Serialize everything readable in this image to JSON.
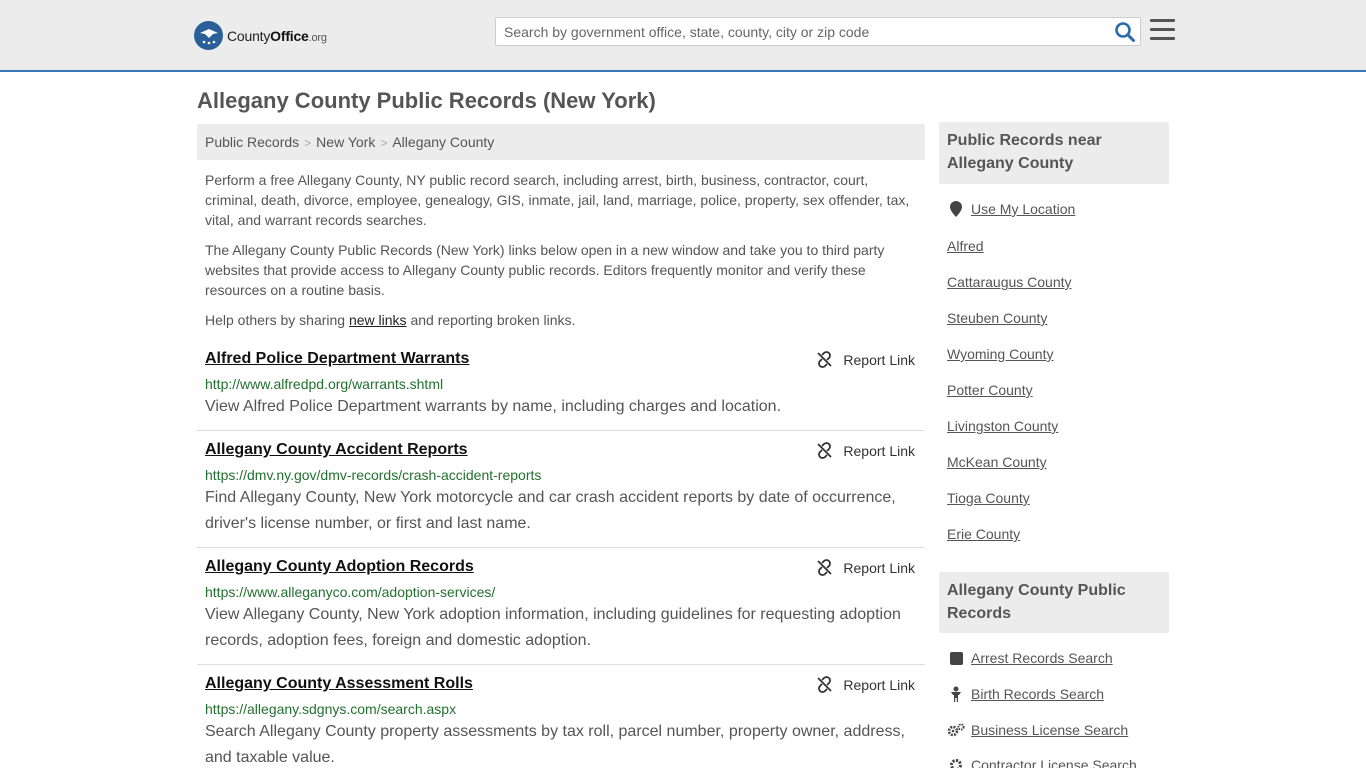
{
  "header": {
    "logo": {
      "county": "County",
      "office": "Office",
      "tld": ".org"
    },
    "search_placeholder": "Search by government office, state, county, city or zip code"
  },
  "page_title": "Allegany County Public Records (New York)",
  "breadcrumb": [
    "Public Records",
    "New York",
    "Allegany County"
  ],
  "intro": {
    "p1": "Perform a free Allegany County, NY public record search, including arrest, birth, business, contractor, court, criminal, death, divorce, employee, genealogy, GIS, inmate, jail, land, marriage, police, property, sex offender, tax, vital, and warrant records searches.",
    "p2": "The Allegany County Public Records (New York) links below open in a new window and take you to third party websites that provide access to Allegany County public records. Editors frequently monitor and verify these resources on a routine basis.",
    "p3_before": "Help others by sharing ",
    "p3_link": "new links",
    "p3_after": " and reporting broken links."
  },
  "report_label": "Report Link",
  "records": [
    {
      "title": "Alfred Police Department Warrants",
      "url": "http://www.alfredpd.org/warrants.shtml",
      "desc": "View Alfred Police Department warrants by name, including charges and location."
    },
    {
      "title": "Allegany County Accident Reports",
      "url": "https://dmv.ny.gov/dmv-records/crash-accident-reports",
      "desc": "Find Allegany County, New York motorcycle and car crash accident reports by date of occurrence, driver's license number, or first and last name."
    },
    {
      "title": "Allegany County Adoption Records",
      "url": "https://www.alleganyco.com/adoption-services/",
      "desc": "View Allegany County, New York adoption information, including guidelines for requesting adoption records, adoption fees, foreign and domestic adoption."
    },
    {
      "title": "Allegany County Assessment Rolls",
      "url": "https://allegany.sdgnys.com/search.aspx",
      "desc": "Search Allegany County property assessments by tax roll, parcel number, property owner, address, and taxable value."
    }
  ],
  "sidebar": {
    "near_heading": "Public Records near Allegany County",
    "use_location": "Use My Location",
    "nearby": [
      "Alfred",
      "Cattaraugus County",
      "Steuben County",
      "Wyoming County",
      "Potter County",
      "Livingston County",
      "McKean County",
      "Tioga County",
      "Erie County"
    ],
    "records_heading": "Allegany County Public Records",
    "record_links": [
      {
        "label": "Arrest Records Search",
        "icon": "square-icon"
      },
      {
        "label": "Birth Records Search",
        "icon": "baby-icon"
      },
      {
        "label": "Business License Search",
        "icon": "gears-icon"
      },
      {
        "label": "Contractor License Search",
        "icon": "gear-icon"
      }
    ]
  }
}
